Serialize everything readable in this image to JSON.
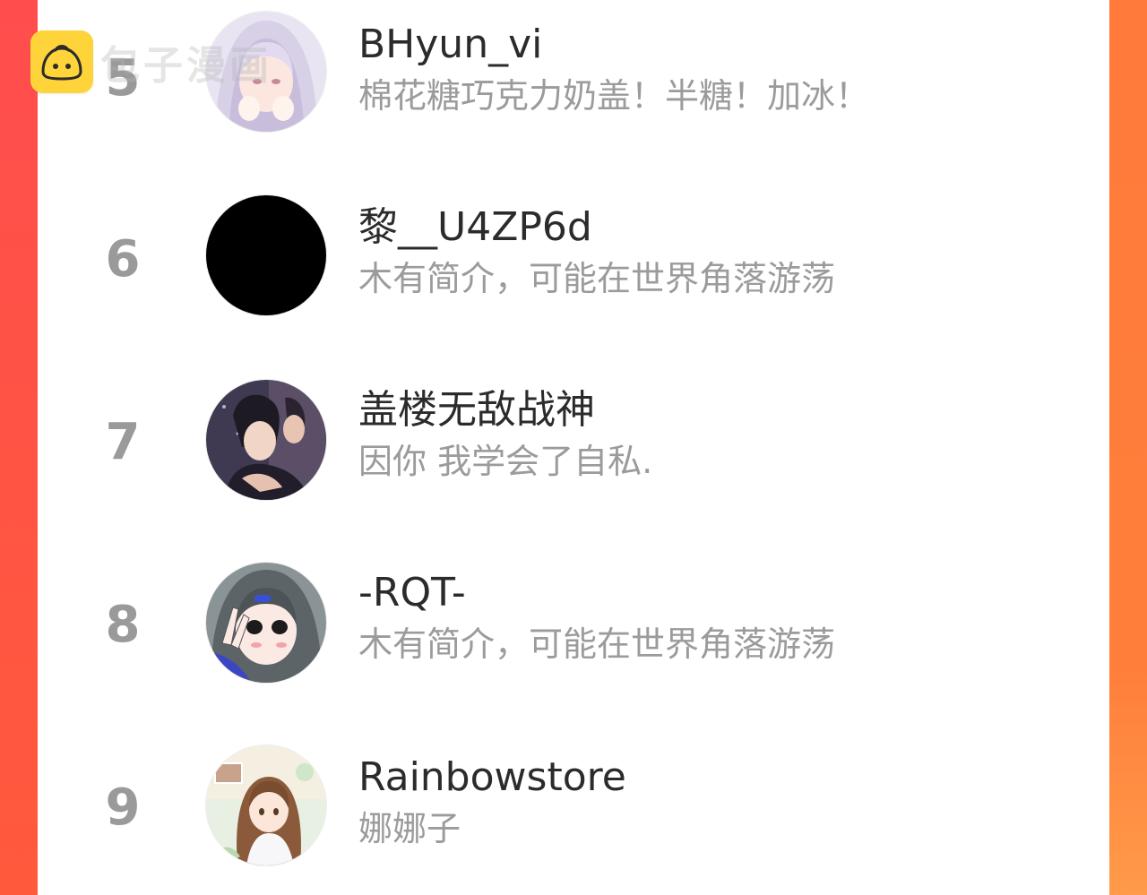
{
  "watermark": {
    "text": "包子漫画",
    "logo_icon": "baozi-logo-icon",
    "logo_color": "#ffd43b"
  },
  "theme": {
    "frame_color": "#ff5e3a",
    "rank_color": "#9a9a9a",
    "name_color": "#2b2b2b",
    "bio_color": "#9b9b9b"
  },
  "leaderboard": [
    {
      "rank": "5",
      "name": "BHyun_vi",
      "bio": "棉花糖巧克力奶盖！半糖！加冰！",
      "avatar_icon": "anime-girl-white-hair-avatar"
    },
    {
      "rank": "6",
      "name": "黎__U4ZP6d",
      "bio": "木有简介，可能在世界角落游荡",
      "avatar_icon": "black-circle-avatar"
    },
    {
      "rank": "7",
      "name": "盖楼无敌战神",
      "bio": "因你 我学会了自私.",
      "avatar_icon": "anime-couple-avatar"
    },
    {
      "rank": "8",
      "name": "-RQT-",
      "bio": "木有简介，可能在世界角落游荡",
      "avatar_icon": "anime-girl-peace-sign-avatar"
    },
    {
      "rank": "9",
      "name": "Rainbowstore",
      "bio": "娜娜子",
      "avatar_icon": "anime-girl-brown-hair-avatar"
    }
  ]
}
